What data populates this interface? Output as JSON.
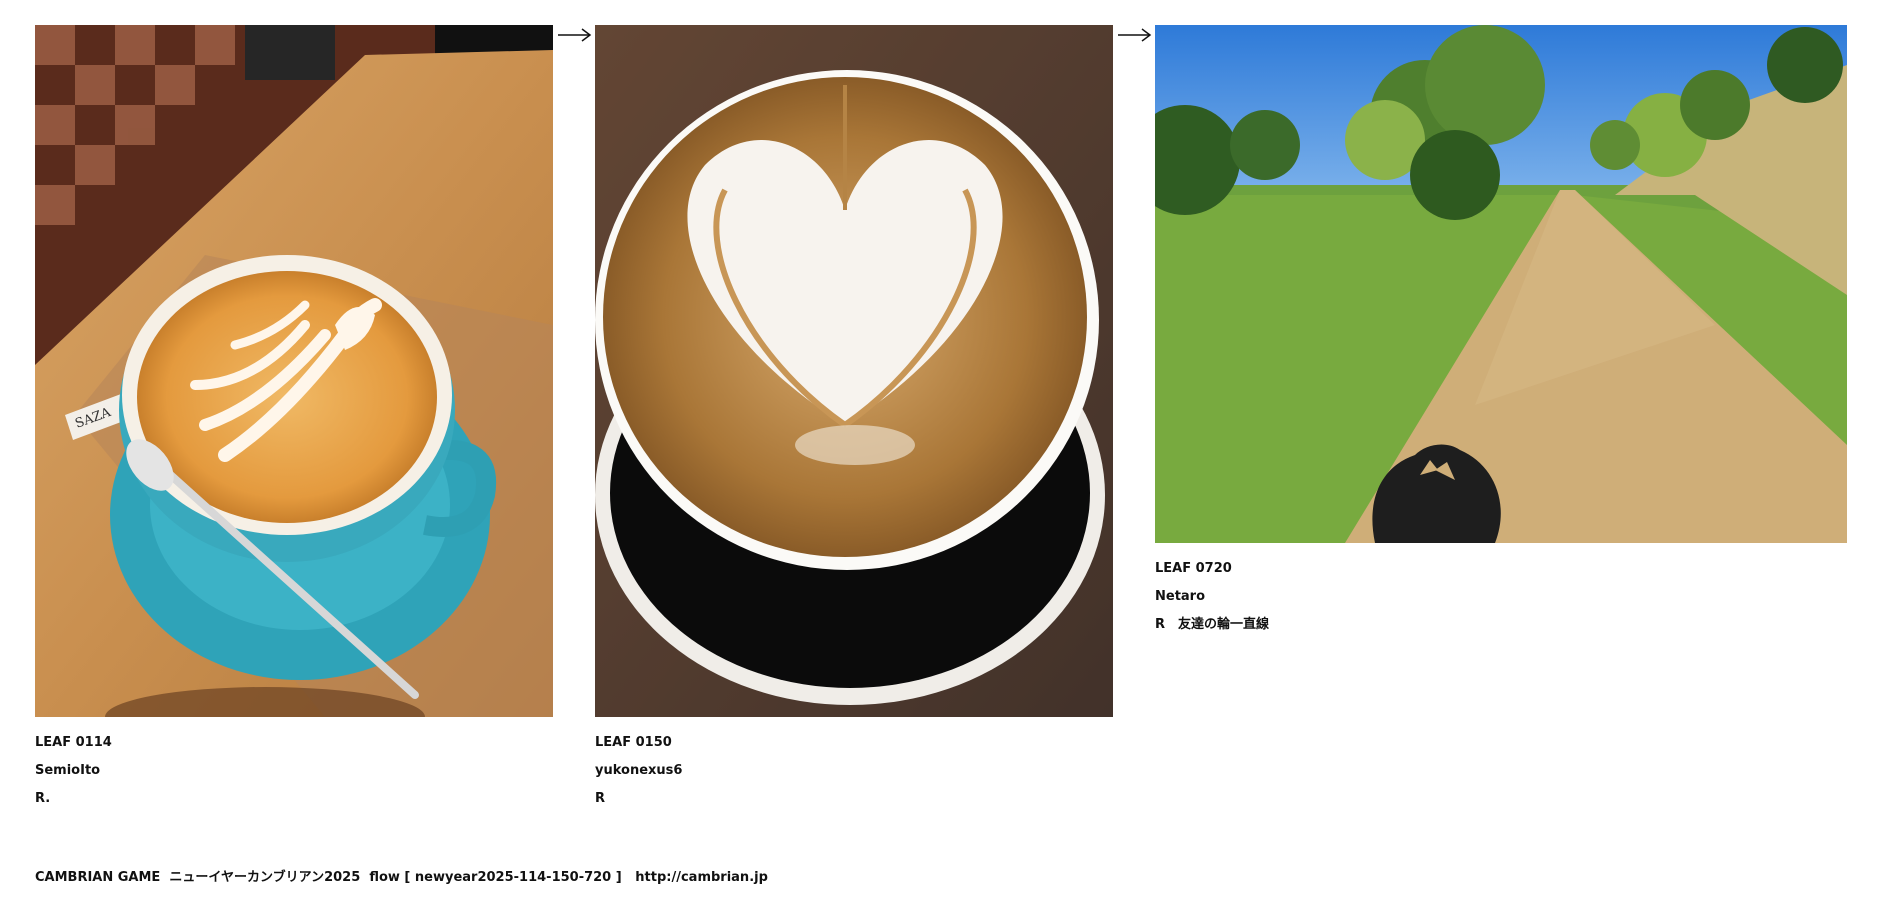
{
  "leaves": [
    {
      "code": "LEAF 0114",
      "author": "SemioIto",
      "note": "R.",
      "image": "latte-art-rosetta-teal-cup",
      "saucer_text": "SAZA"
    },
    {
      "code": "LEAF 0150",
      "author": "yukonexus6",
      "note": "R",
      "image": "latte-art-heart-black-cup"
    },
    {
      "code": "LEAF 0720",
      "author": "Netaro",
      "note": "R　友達の輪一直線",
      "image": "dirt-path-through-grass-with-shadow"
    }
  ],
  "arrows": [
    "right-arrow-icon",
    "right-arrow-icon"
  ],
  "footer": {
    "title": "CAMBRIAN GAME",
    "subtitle": "ニューイヤーカンブリアン2025",
    "flow": "flow [ newyear2025-114-150-720 ]",
    "url": "http://cambrian.jp"
  }
}
